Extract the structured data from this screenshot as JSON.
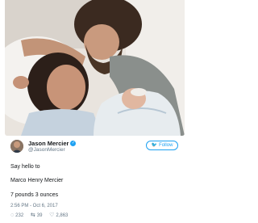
{
  "tweet": {
    "author_name": "Jason Mercier",
    "author_handle": "@JasonMercier",
    "verified": true,
    "follow_label": "Follow",
    "lines": [
      "Say hello to",
      "Marco Henry Mercier",
      "7 pounds 3 ounces"
    ],
    "timestamp": "2:56 PM - Oct 6, 2017",
    "replies": "232",
    "retweets": "39",
    "likes": "2,863"
  },
  "icons": {
    "reply": "reply-icon",
    "retweet": "retweet-icon",
    "like": "heart-icon",
    "verified": "verified-badge-icon",
    "follow": "twitter-bird-icon"
  },
  "colors": {
    "accent": "#1da1f2",
    "secondary_text": "#657786",
    "primary_text": "#14171a"
  }
}
